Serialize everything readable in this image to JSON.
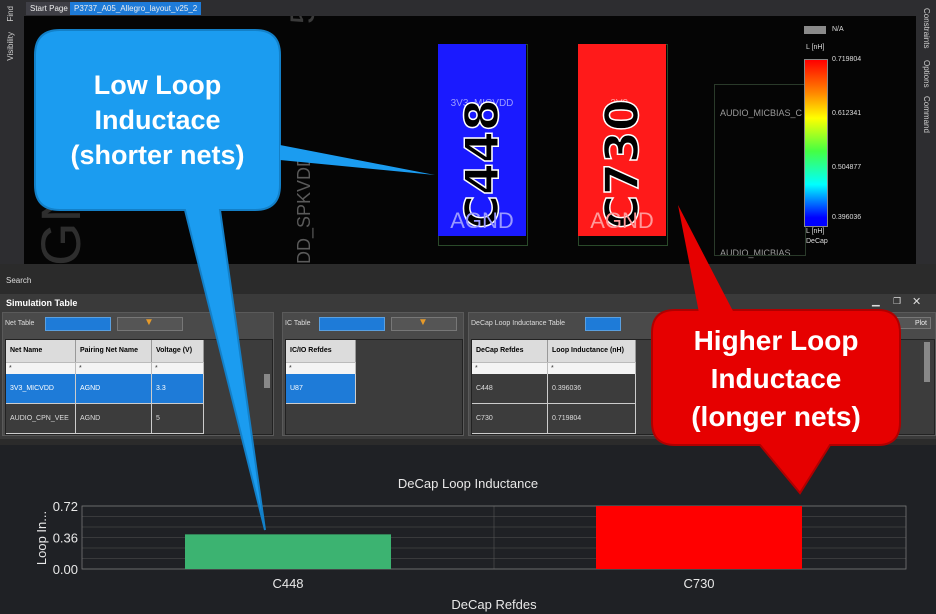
{
  "side": {
    "visibility": "Visibility",
    "find": "Find",
    "constraints": "Constraints",
    "options": "Options",
    "command": "Command"
  },
  "tabs": [
    "Start Page",
    "P3737_A05_Allegro_layout_v25_2"
  ],
  "canvas": {
    "bg_labels": [
      "5V",
      "GND",
      "VDD_SPKVDD",
      "AUDIO_MICBIAS_C",
      "AUDIO_MICBIAS"
    ],
    "comp1": {
      "ref": "C448",
      "net": "3V3_MICVDD",
      "gnd": "AGND",
      "color": "#1a1aff"
    },
    "comp2": {
      "ref": "C730",
      "net": "3V3_",
      "gnd": "AGND",
      "color": "#ff1a1a"
    }
  },
  "legend": {
    "na": "N/A",
    "unit_top": "L [nH]",
    "unit_bottom": "L [nH]",
    "title": "DeCap",
    "ticks": [
      "0.719804",
      "0.612341",
      "0.504877",
      "0.396036"
    ]
  },
  "search": "Search",
  "sim": {
    "title": "Simulation Table",
    "net_table_label": "Net Table",
    "ic_table_label": "IC Table",
    "decap_table_label": "DeCap Loop Inductance Table",
    "plot_label": "Plot",
    "net_headers": [
      "Net Name",
      "Pairing Net Name",
      "Voltage (V)"
    ],
    "net_rows": [
      [
        "3V3_MICVDD",
        "AGND",
        "3.3"
      ],
      [
        "AUDIO_CPN_VEE",
        "AGND",
        "5"
      ]
    ],
    "ic_header": "IC/IO Refdes",
    "ic_rows": [
      "U87"
    ],
    "decap_headers": [
      "DeCap Refdes",
      "Loop Inductance (nH)"
    ],
    "decap_rows": [
      [
        "C448",
        "0.396036"
      ],
      [
        "C730",
        "0.719804"
      ]
    ],
    "filter": "*"
  },
  "callouts": {
    "low": "Low Loop Inductace (shorter nets)",
    "high": "Higher Loop Inductace (longer nets)"
  },
  "chart_data": {
    "type": "bar",
    "title": "DeCap Loop Inductance",
    "xlabel": "DeCap Refdes",
    "ylabel": "Loop In...",
    "categories": [
      "C448",
      "C730"
    ],
    "values": [
      0.396036,
      0.719804
    ],
    "colors": [
      "#3cb371",
      "#ff0000"
    ],
    "yticks": [
      "0.72",
      "0.36",
      "0.00"
    ],
    "ylim": [
      0,
      0.72
    ]
  }
}
